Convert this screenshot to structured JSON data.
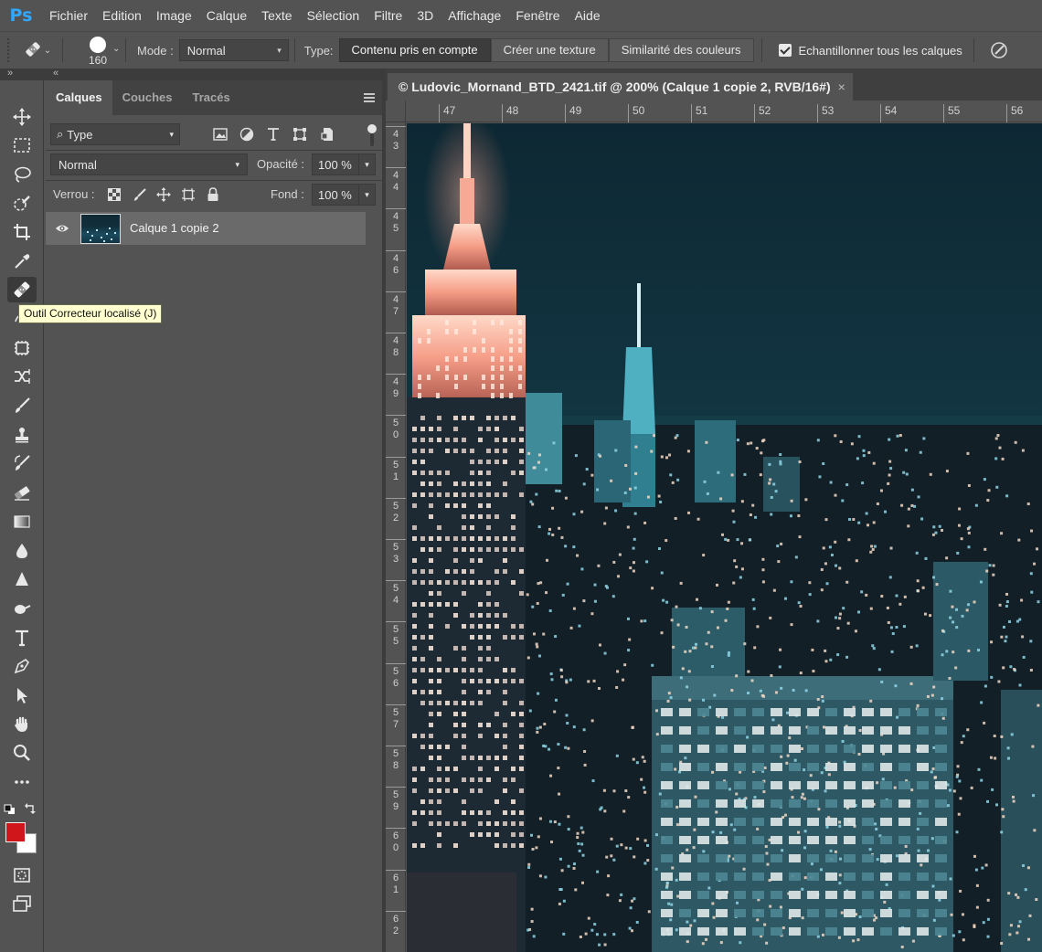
{
  "app": {
    "logo_text": "Ps",
    "accent": "#31a8ff"
  },
  "menu": [
    "Fichier",
    "Edition",
    "Image",
    "Calque",
    "Texte",
    "Sélection",
    "Filtre",
    "3D",
    "Affichage",
    "Fenêtre",
    "Aide"
  ],
  "options": {
    "tool_icon": "spot-healing-brush-icon",
    "brush_size": "160",
    "mode_label": "Mode :",
    "mode_value": "Normal",
    "type_label": "Type:",
    "type_buttons": [
      "Contenu pris en compte",
      "Créer une texture",
      "Similarité des couleurs"
    ],
    "active_type": "Contenu pris en compte",
    "sample_all_label": "Echantillonner tous les calques",
    "sample_all_checked": true,
    "pressure_icon": "pressure-size-icon"
  },
  "strip": {
    "left_collapse": "»",
    "right_collapse": "«"
  },
  "toolbar": {
    "tools": [
      "move-icon",
      "marquee-icon",
      "lasso-icon",
      "quick-selection-icon",
      "crop-icon",
      "eyedropper-icon",
      "spot-healing-brush-icon",
      "patch-icon",
      "frame-icon",
      "content-aware-move-icon",
      "brush-icon",
      "clone-stamp-icon",
      "history-brush-icon",
      "eraser-icon",
      "gradient-icon",
      "blur-icon",
      "sharpen-icon",
      "dodge-icon",
      "type-icon",
      "pen-icon",
      "path-selection-icon",
      "hand-icon",
      "zoom-icon",
      "more-tools-icon"
    ],
    "active_tool": "spot-healing-brush-icon",
    "foreground_color": "#d0161a",
    "background_color": "#ffffff",
    "tooltip": "Outil Correcteur localisé (J)"
  },
  "layers_panel": {
    "tabs": [
      "Calques",
      "Couches",
      "Tracés"
    ],
    "active_tab": "Calques",
    "filter_value": "Type",
    "blend_mode": "Normal",
    "opacity_label": "Opacité :",
    "opacity_value": "100 %",
    "lock_label": "Verrou :",
    "fill_label": "Fond :",
    "fill_value": "100 %",
    "layers": [
      {
        "name": "Calque 1 copie 2",
        "visible": true,
        "selected": true
      }
    ]
  },
  "document": {
    "tab_title": "© Ludovic_Mornand_BTD_2421.tif @ 200% (Calque 1 copie 2, RVB/16#)",
    "close_glyph": "×",
    "ruler_h": [
      "47",
      "48",
      "49",
      "50",
      "51",
      "52",
      "53",
      "54",
      "55",
      "56"
    ],
    "ruler_v": [
      "43",
      "44",
      "45",
      "46",
      "47",
      "48",
      "49",
      "50",
      "51",
      "52",
      "53",
      "54",
      "55",
      "56",
      "57",
      "58",
      "59",
      "60",
      "61",
      "62"
    ]
  }
}
